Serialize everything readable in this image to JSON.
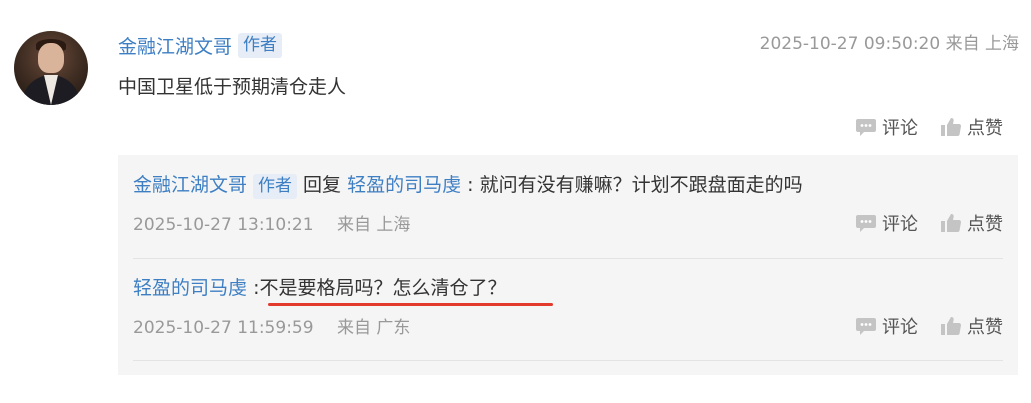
{
  "main_comment": {
    "author": "金融江湖文哥",
    "author_badge": "作者",
    "time_location": "2025-10-27 09:50:20 来自 上海",
    "text": "中国卫星低于预期清仓走人",
    "comment_label": "评论",
    "like_label": "点赞"
  },
  "replies": [
    {
      "author": "金融江湖文哥",
      "author_badge": "作者",
      "reply_word": "回复",
      "target": "轻盈的司马虔",
      "separator": ":",
      "text": "就问有没有赚嘛？计划不跟盘面走的吗",
      "time": "2025-10-27 13:10:21",
      "location": "来自 上海",
      "comment_label": "评论",
      "like_label": "点赞"
    },
    {
      "author": "轻盈的司马虔",
      "separator": ":",
      "text": "不是要格局吗？怎么清仓了？",
      "time": "2025-10-27 11:59:59",
      "location": "来自 广东",
      "comment_label": "评论",
      "like_label": "点赞"
    }
  ],
  "colors": {
    "link": "#3e7fc4",
    "badge_bg": "#e6edf6",
    "underline": "#e23b2e",
    "meta": "#999999"
  }
}
